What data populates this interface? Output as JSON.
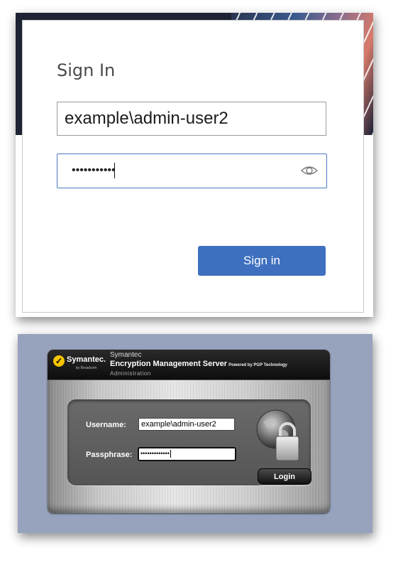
{
  "microsoft_signin": {
    "title": "Sign In",
    "username_value": "example\\admin-user2",
    "password_masked": "•••••••••••",
    "show_password_icon": "eye-icon",
    "signin_button_label": "Sign in",
    "accent_color": "#3f70bf"
  },
  "symantec_ems": {
    "logo_text": "Symantec.",
    "logo_sub": "by Broadcom",
    "brand": "Symantec",
    "product_name": "Encryption Management Server",
    "powered_by": "Powered by PGP Technology",
    "subtitle": "Administration",
    "username_label": "Username:",
    "username_value": "example\\admin-user2",
    "passphrase_label": "Passphrase:",
    "passphrase_masked": "•••••••••••••",
    "login_button_label": "Login",
    "lock_icon": "globe-padlock-icon",
    "page_bg_color": "#97a2bc"
  }
}
